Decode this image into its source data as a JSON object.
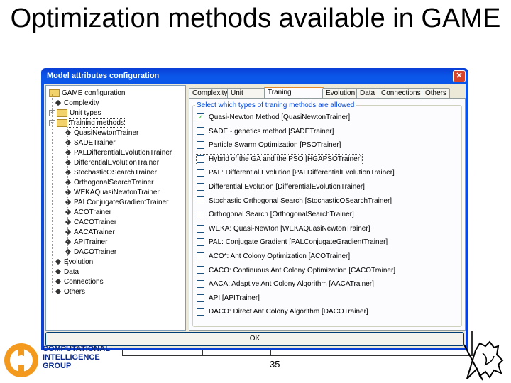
{
  "slide": {
    "title": "Optimization methods available in GAME",
    "page_number": "35"
  },
  "dialog": {
    "title": "Model attributes configuration",
    "close_label": "✕",
    "ok_label": "OK",
    "tree": {
      "root": "GAME configuration",
      "items": [
        {
          "label": "Complexity"
        },
        {
          "label": "Unit types"
        },
        {
          "label": "Training methods"
        },
        {
          "label": "QuasiNewtonTrainer"
        },
        {
          "label": "SADETrainer"
        },
        {
          "label": "PALDifferentialEvolutionTrainer"
        },
        {
          "label": "DifferentialEvolutionTrainer"
        },
        {
          "label": "StochasticOSearchTrainer"
        },
        {
          "label": "OrthogonalSearchTrainer"
        },
        {
          "label": "WEKAQuasiNewtonTrainer"
        },
        {
          "label": "PALConjugateGradientTrainer"
        },
        {
          "label": "ACOTrainer"
        },
        {
          "label": "CACOTrainer"
        },
        {
          "label": "AACATrainer"
        },
        {
          "label": "APITrainer"
        },
        {
          "label": "DACOTrainer"
        },
        {
          "label": "Evolution"
        },
        {
          "label": "Data"
        },
        {
          "label": "Connections"
        },
        {
          "label": "Others"
        }
      ]
    },
    "tabs": [
      "Complexity",
      "Unit types",
      "Traning methods",
      "Evolution",
      "Data",
      "Connections",
      "Others"
    ],
    "active_tab": "Traning methods",
    "group_label": "Select which types of traning methods are allowed",
    "options": [
      {
        "label": "Quasi-Newton Method [QuasiNewtonTrainer]",
        "checked": true
      },
      {
        "label": "SADE - genetics method [SADETrainer]",
        "checked": false
      },
      {
        "label": "Particle Swarm Optimization [PSOTrainer]",
        "checked": false
      },
      {
        "label": "Hybrid of the GA and the PSO [HGAPSOTrainer]",
        "checked": false
      },
      {
        "label": "PAL: Differential Evolution [PALDifferentialEvolutionTrainer]",
        "checked": false
      },
      {
        "label": "Differential Evolution [DifferentialEvolutionTrainer]",
        "checked": false
      },
      {
        "label": "Stochastic Orthogonal Search [StochasticOSearchTrainer]",
        "checked": false
      },
      {
        "label": "Orthogonal Search [OrthogonalSearchTrainer]",
        "checked": false
      },
      {
        "label": "WEKA: Quasi-Newton [WEKAQuasiNewtonTrainer]",
        "checked": false
      },
      {
        "label": "PAL: Conjugate Gradient [PALConjugateGradientTrainer]",
        "checked": false
      },
      {
        "label": "ACO*: Ant Colony Optimization [ACOTrainer]",
        "checked": false
      },
      {
        "label": "CACO: Continuous Ant Colony Optimization [CACOTrainer]",
        "checked": false
      },
      {
        "label": "AACA: Adaptive Ant Colony Algorithm [AACATrainer]",
        "checked": false
      },
      {
        "label": "API [APITrainer]",
        "checked": false
      },
      {
        "label": "DACO: Direct Ant Colony Algorithm [DACOTrainer]",
        "checked": false
      }
    ]
  },
  "logos": {
    "cig_text": [
      "COMPUTATIONAL",
      "INTELLIGENCE",
      "GROUP"
    ]
  },
  "colors": {
    "titlebar": "#0a3fd6",
    "window_bg": "#ece9d8",
    "check": "#21a121",
    "group_label": "#0046d5"
  }
}
